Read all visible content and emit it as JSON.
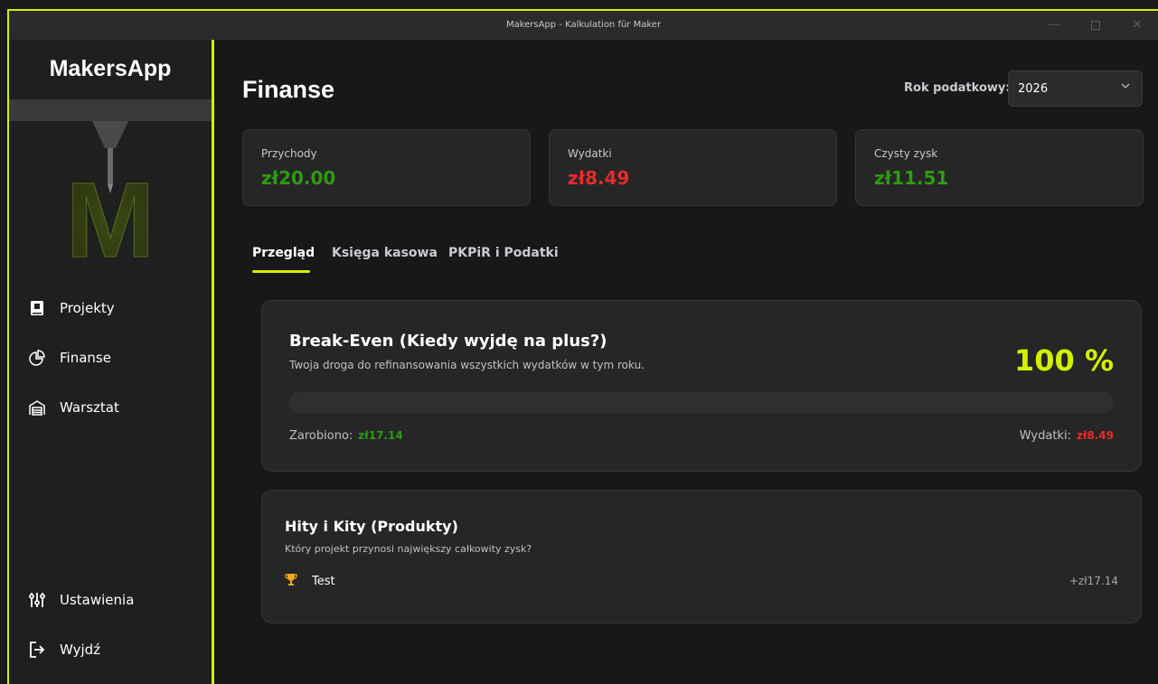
{
  "window": {
    "title": "MakersApp - Kalkulation für Maker"
  },
  "sidebar": {
    "brand": "MakersApp",
    "items": [
      {
        "label": "Projekty",
        "icon": "book-icon"
      },
      {
        "label": "Finanse",
        "icon": "pie-chart-icon"
      },
      {
        "label": "Warsztat",
        "icon": "garage-icon"
      }
    ],
    "bottom_items": [
      {
        "label": "Ustawienia",
        "icon": "sliders-icon"
      },
      {
        "label": "Wyjdź",
        "icon": "logout-icon"
      }
    ]
  },
  "header": {
    "title": "Finanse",
    "tax_year_label": "Rok podatkowy:",
    "tax_year_value": "2026"
  },
  "summary": [
    {
      "label": "Przychody",
      "value": "zł20.00",
      "color": "#2e9b14"
    },
    {
      "label": "Wydatki",
      "value": "zł8.49",
      "color": "#e82a2a"
    },
    {
      "label": "Czysty zysk",
      "value": "zł11.51",
      "color": "#2e9b14"
    }
  ],
  "tabs": [
    {
      "label": "Przegląd",
      "active": true
    },
    {
      "label": "Księga kasowa",
      "active": false
    },
    {
      "label": "PKPiR i Podatki",
      "active": false
    }
  ],
  "break_even": {
    "title": "Break-Even (Kiedy wyjdę na plus?)",
    "subtitle": "Twoja droga do refinansowania wszystkich wydatków w tym roku.",
    "percent": "100 %",
    "earned_label": "Zarobiono:",
    "earned_value": "zł17.14",
    "spent_label": "Wydatki:",
    "spent_value": "zł8.49"
  },
  "hits": {
    "title": "Hity i Kity (Produkty)",
    "subtitle": "Który projekt przynosi największy całkowity zysk?",
    "rows": [
      {
        "name": "Test",
        "value": "+zł17.14",
        "icon": "trophy-icon"
      }
    ]
  },
  "colors": {
    "accent": "#d4f000",
    "positive": "#2e9b14",
    "negative": "#e82a2a"
  }
}
